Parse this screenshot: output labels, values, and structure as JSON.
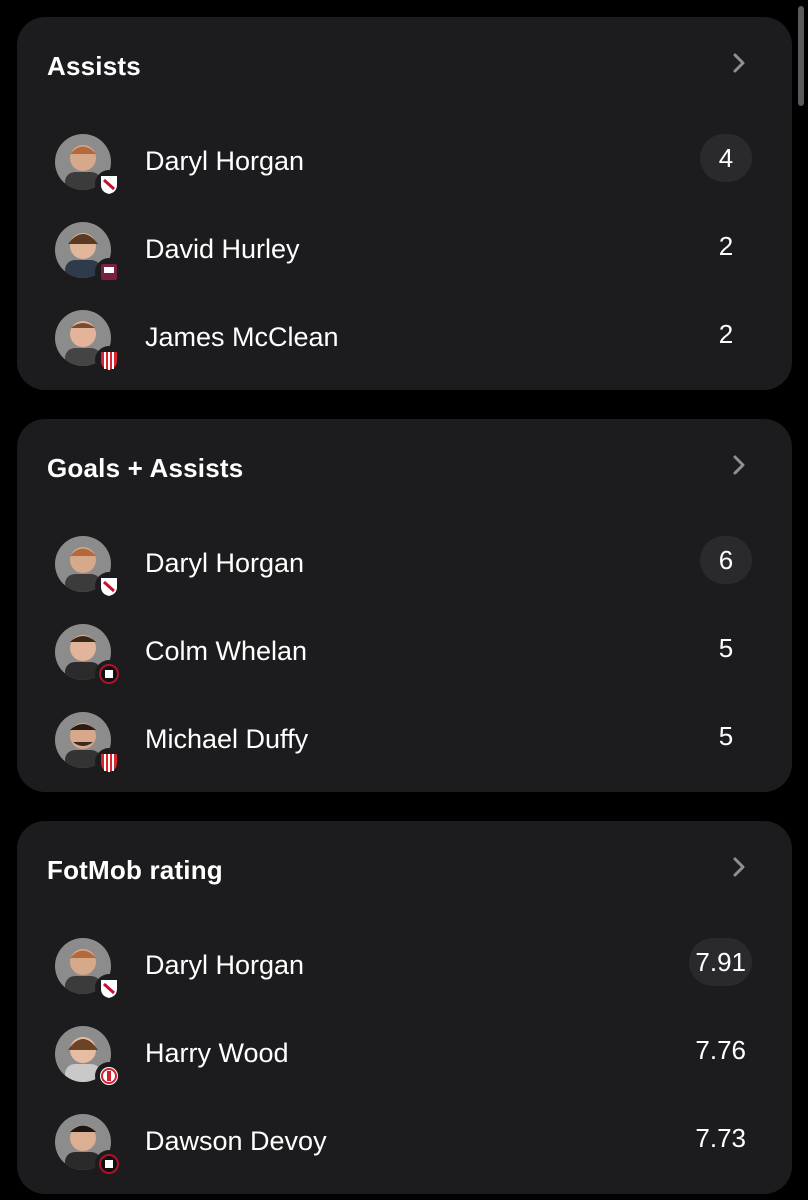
{
  "colors": {
    "background": "#000000",
    "card": "#1c1c1e",
    "highlight": "#2a2a2c",
    "text": "#ffffff",
    "chevron": "#8e8e93"
  },
  "cards": [
    {
      "title": "Assists",
      "chevron_icon": "chevron-right-icon",
      "players": [
        {
          "name": "Daryl Horgan",
          "value": "4",
          "badge": "dundalk-crest",
          "badge_color": "#c8102e"
        },
        {
          "name": "David Hurley",
          "value": "2",
          "badge": "galway-crest",
          "badge_color": "#7a1f3d"
        },
        {
          "name": "James McClean",
          "value": "2",
          "badge": "derry-crest",
          "badge_color": "#d7262e"
        }
      ]
    },
    {
      "title": "Goals + Assists",
      "chevron_icon": "chevron-right-icon",
      "players": [
        {
          "name": "Daryl Horgan",
          "value": "6",
          "badge": "dundalk-crest",
          "badge_color": "#c8102e"
        },
        {
          "name": "Colm Whelan",
          "value": "5",
          "badge": "bohemians-crest",
          "badge_color": "#b0102a"
        },
        {
          "name": "Michael Duffy",
          "value": "5",
          "badge": "derry-crest",
          "badge_color": "#d7262e"
        }
      ]
    },
    {
      "title": "FotMob rating",
      "chevron_icon": "chevron-right-icon",
      "players": [
        {
          "name": "Daryl Horgan",
          "value": "7.91",
          "badge": "dundalk-crest",
          "badge_color": "#c8102e"
        },
        {
          "name": "Harry Wood",
          "value": "7.76",
          "badge": "shelbourne-crest",
          "badge_color": "#d2202e"
        },
        {
          "name": "Dawson Devoy",
          "value": "7.73",
          "badge": "bohemians-crest",
          "badge_color": "#b0102a"
        }
      ]
    }
  ]
}
